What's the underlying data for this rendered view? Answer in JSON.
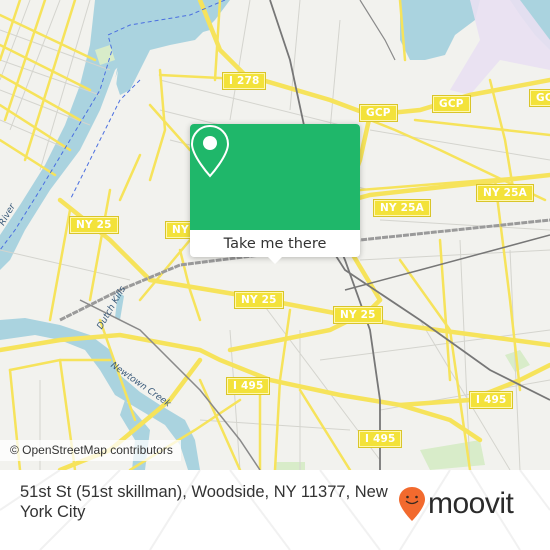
{
  "map": {
    "colors": {
      "land": "#f2f2ee",
      "water": "#aad3df",
      "road_major": "#f6e35b",
      "road_minor": "#d6d6d0",
      "rail": "#8a8a8a",
      "park": "#d8ecc9",
      "airport": "#e9e0f2"
    },
    "shields": [
      {
        "label": "I 278"
      },
      {
        "label": "GCP"
      },
      {
        "label": "GCP"
      },
      {
        "label": "GCP"
      },
      {
        "label": "NY 25A"
      },
      {
        "label": "NY 25A"
      },
      {
        "label": "NY 25"
      },
      {
        "label": "NY"
      },
      {
        "label": "NY 25"
      },
      {
        "label": "NY 25"
      },
      {
        "label": "I 495"
      },
      {
        "label": "I 495"
      },
      {
        "label": "I 495"
      }
    ],
    "water_labels": [
      {
        "label": "River"
      },
      {
        "label": "Dutch Kills"
      },
      {
        "label": "Newtown Creek"
      }
    ],
    "attribution": "© OpenStreetMap contributors"
  },
  "popup": {
    "button_label": "Take me there",
    "accent_color": "#1fb76a",
    "icon": "map-pin-icon"
  },
  "footer": {
    "address": "51st St (51st skillman), Woodside, NY 11377, New York City",
    "brand": "moovit",
    "brand_color": "#f26a2e",
    "logo_icon": "moovit-pin-smile-icon"
  }
}
